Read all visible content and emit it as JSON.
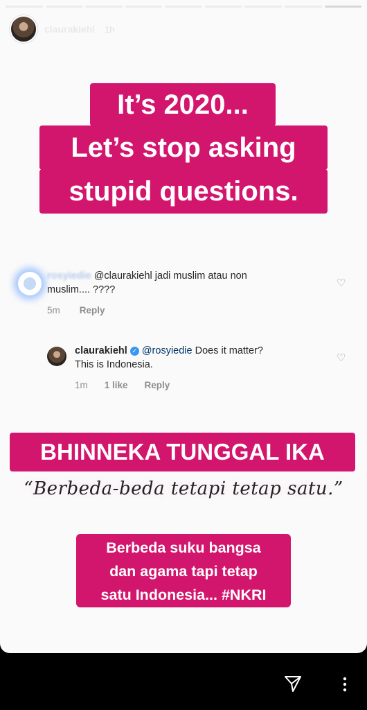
{
  "story": {
    "progress_segments": 9,
    "progress_done": 8
  },
  "header": {
    "username": "claurakiehl",
    "time": "1h"
  },
  "captions": {
    "line1": "It’s 2020...",
    "line2": "Let’s stop asking",
    "line3": "stupid questions."
  },
  "comment1": {
    "username": "rosyiedie",
    "mention": "@claurakiehl",
    "text_part1": " jadi  muslim  atau non",
    "text_part2": "muslim.... ????",
    "time": "5m",
    "reply": "Reply"
  },
  "comment2": {
    "username": "claurakiehl",
    "mention": "@rosyiedie",
    "text_part1": " Does it matter?",
    "text_part2": "This is Indonesia.",
    "time": "1m",
    "likes": "1 like",
    "reply": "Reply"
  },
  "banner": {
    "title": "BHINNEKA TUNGGAL IKA",
    "script": "“Berbeda-beda tetapi tetap satu.”",
    "footer_line1": "Berbeda suku bangsa",
    "footer_line2": "dan agama tapi tetap",
    "footer_line3": "satu Indonesia... #NKRI"
  },
  "colors": {
    "accent": "#d3166d",
    "verified": "#3897f0"
  },
  "icons": {
    "send": "send-icon",
    "more": "more-vertical-icon",
    "heart": "heart-icon",
    "verified": "verified-badge-icon"
  }
}
